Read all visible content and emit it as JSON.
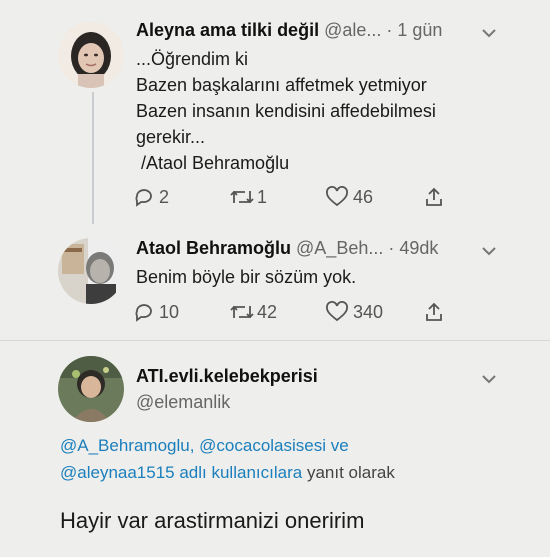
{
  "tweets": [
    {
      "display_name": "Aleyna ama tilki değil",
      "handle": "@ale...",
      "time": "· 1 gün",
      "lines": [
        "...Öğrendim ki",
        "Bazen başkalarını affetmek yetmiyor",
        "Bazen insanın kendisini affedebilmesi",
        "gerekir...",
        " /Ataol Behramoğlu"
      ],
      "replies": "2",
      "retweets": "1",
      "likes": "46"
    },
    {
      "display_name": "Ataol Behramoğlu",
      "handle": "@A_Beh...",
      "time": "· 49dk",
      "lines": [
        "Benim böyle bir sözüm yok."
      ],
      "replies": "10",
      "retweets": "42",
      "likes": "340"
    }
  ],
  "reply": {
    "display_name": "ATI.evli.kelebekperisi",
    "handle": "@elemanlik",
    "reply_to_users": "@A_Behramoglu, @cocacolasisesi ve",
    "reply_to_users_2": "@aleynaa1515 adlı kullanıcılara",
    "reply_to_suffix": "yanıt olarak",
    "text": "Hayir var arastirmanizi oneririm"
  },
  "icons": {
    "reply": "reply-icon",
    "retweet": "retweet-icon",
    "like": "heart-icon",
    "share": "share-icon",
    "more": "chevron-down-icon"
  },
  "colors": {
    "link": "#1b7fbd",
    "background": "#eeeeec",
    "muted": "#666666"
  }
}
